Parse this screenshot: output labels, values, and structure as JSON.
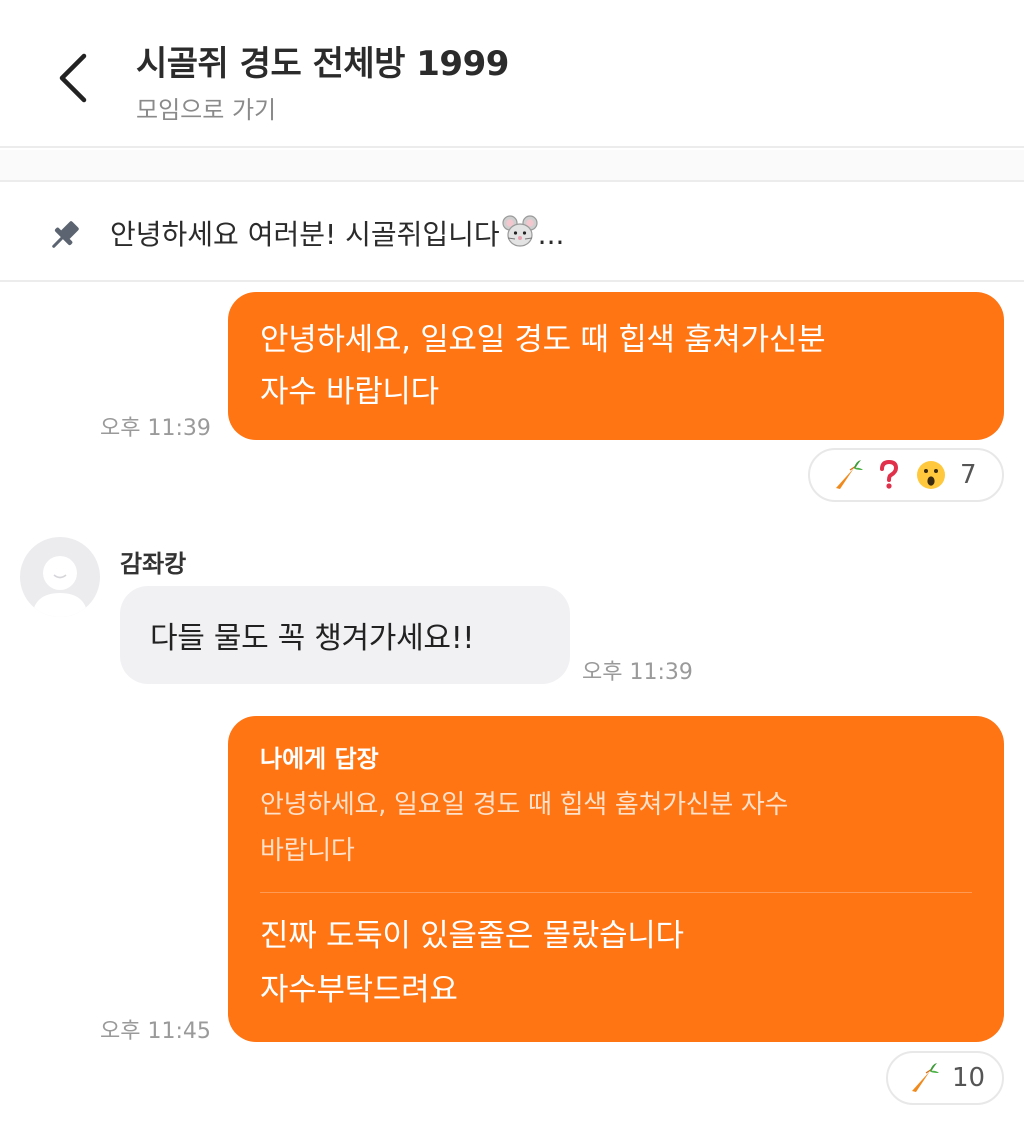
{
  "header": {
    "title": "시골쥐 경도 전체방 1999",
    "subtitle": "모임으로 가기"
  },
  "notice": {
    "text": "안녕하세요 여러분! 시골쥐입니다",
    "ellipsis": "..."
  },
  "messages": [
    {
      "text_line1": "안녕하세요, 일요일 경도 때 힙색 훔쳐가신분",
      "text_line2": "자수 바랍니다",
      "time": "오후 11:39",
      "reactions": {
        "icons": [
          "carrot-icon",
          "question-mark-icon",
          "surprised-face-icon"
        ],
        "count": "7"
      }
    },
    {
      "sender": "감좌캉",
      "text": "다들 물도 꼭 챙겨가세요!!",
      "time": "오후 11:39"
    },
    {
      "reply_label": "나에게 답장",
      "quote_line1": "안녕하세요, 일요일 경도 때 힙색 훔쳐가신분 자수",
      "quote_line2": "바랍니다",
      "text_line1": "진짜 도둑이 있을줄은 몰랐습니다",
      "text_line2": "자수부탁드려요",
      "time": "오후 11:45",
      "reactions": {
        "icons": [
          "carrot-icon"
        ],
        "count": "10"
      }
    }
  ],
  "colors": {
    "accent": "#ff7413",
    "incoming_bubble": "#f1f1f4",
    "timestamp": "#9a9a9a"
  }
}
